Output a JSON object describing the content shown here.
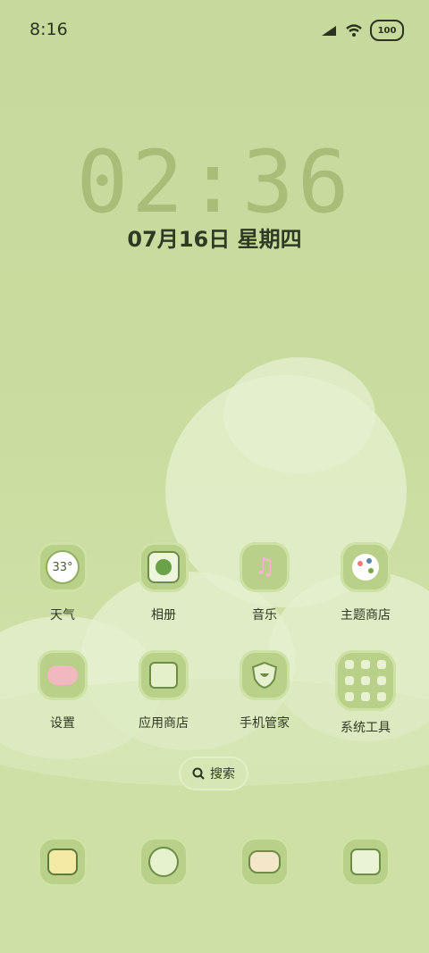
{
  "status_bar": {
    "time": "8:16",
    "battery": "100"
  },
  "lock_clock": {
    "time": "02:36",
    "date": "07月16日 星期四"
  },
  "apps_row1": [
    {
      "label": "天气",
      "icon": "weather-icon",
      "temp": "33°"
    },
    {
      "label": "相册",
      "icon": "gallery-icon"
    },
    {
      "label": "音乐",
      "icon": "music-icon"
    },
    {
      "label": "主题商店",
      "icon": "theme-store-icon"
    }
  ],
  "apps_row2": [
    {
      "label": "设置",
      "icon": "settings-icon"
    },
    {
      "label": "应用商店",
      "icon": "app-store-icon"
    },
    {
      "label": "手机管家",
      "icon": "phone-manager-icon"
    },
    {
      "label": "系统工具",
      "icon": "system-tools-folder-icon"
    }
  ],
  "search": {
    "label": "搜索"
  },
  "dock": [
    {
      "icon": "phone-icon"
    },
    {
      "icon": "browser-icon"
    },
    {
      "icon": "messages-icon"
    },
    {
      "icon": "camera-icon"
    }
  ],
  "colors": {
    "background": "#c6da9d",
    "tile": "#b9d089",
    "text": "#2f3a24",
    "clock": "#a7bd78"
  }
}
